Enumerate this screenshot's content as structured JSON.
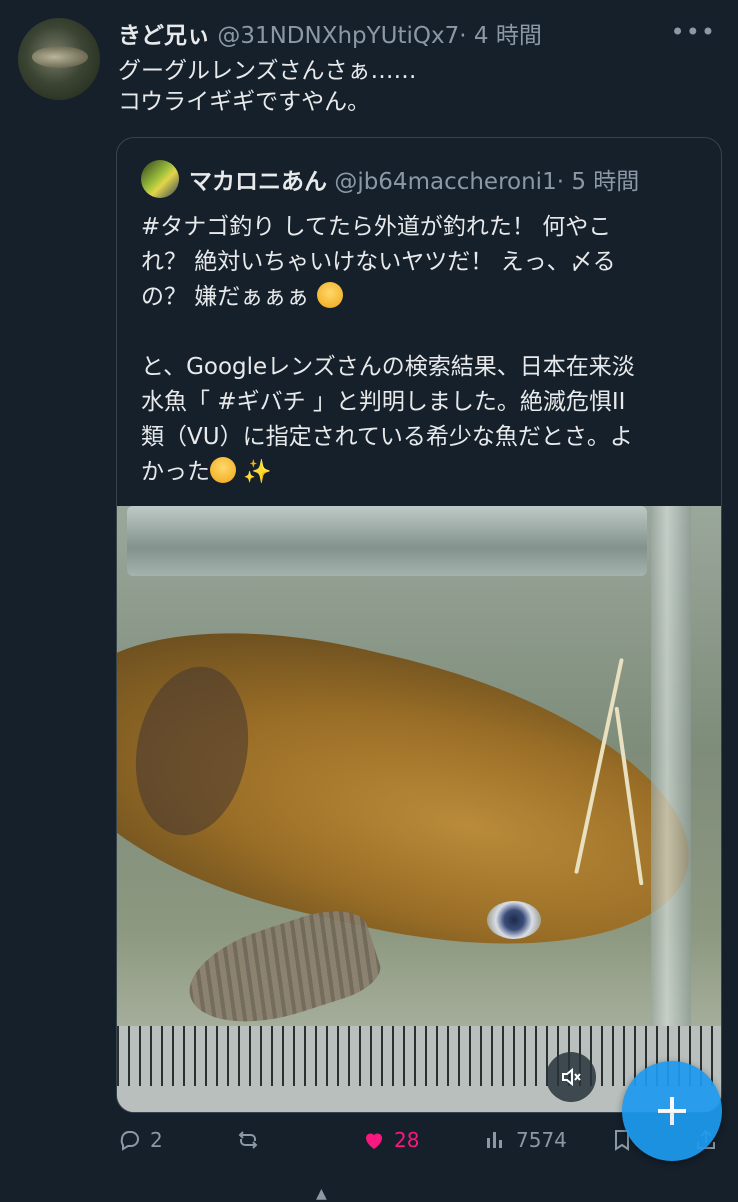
{
  "tweet": {
    "author_name": "きど兄ぃ",
    "author_handle": "@31NDNXhpYUtiQx7",
    "separator": "·",
    "time": "4 時間",
    "more": "•••",
    "text_line1": "グーグルレンズさんさぁ……",
    "text_line2": "コウライギギですやん。"
  },
  "quote": {
    "author_name": "マカロニあん",
    "author_handle": "@jb64maccheroni1",
    "separator": "·",
    "time": "5 時間",
    "p1_line1": "#タナゴ釣り してたら外道が釣れた！ 何やこ",
    "p1_line2": "れ？ 絶対いちゃいけないヤツだ！ えっ、〆る",
    "p1_line3": "の？ 嫌だぁぁぁ",
    "p2_line1": "と、Googleレンズさんの検索結果、日本在来淡",
    "p2_line2": "水魚「 #ギバチ 」と判明しました。絶滅危惧II",
    "p2_line3": "類（VU）に指定されている希少な魚だとさ。よ",
    "p2_line4": "かった",
    "sparkle": "✨"
  },
  "actions": {
    "replies": "2",
    "likes": "28",
    "views": "7574"
  },
  "colors": {
    "background": "#15202b",
    "accent": "#1d9bf0",
    "like": "#f91880",
    "secondary_text": "#8b98a5"
  }
}
